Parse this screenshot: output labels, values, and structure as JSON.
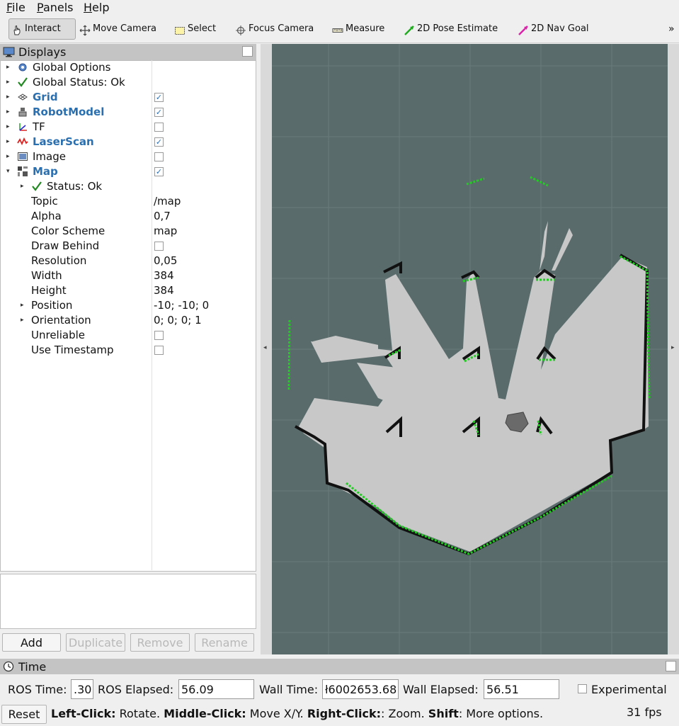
{
  "menubar": {
    "items": [
      {
        "label": "File"
      },
      {
        "label": "Panels"
      },
      {
        "label": "Help"
      }
    ]
  },
  "toolbar": {
    "tools": [
      {
        "label": "Interact",
        "icon": "hand-pointer-icon",
        "active": true
      },
      {
        "label": "Move Camera",
        "icon": "move-arrows-icon"
      },
      {
        "label": "Select",
        "icon": "select-rectangle-icon"
      },
      {
        "label": "Focus Camera",
        "icon": "focus-crosshair-icon"
      },
      {
        "label": "Measure",
        "icon": "ruler-icon"
      },
      {
        "label": "2D Pose Estimate",
        "icon": "green-arrow-icon"
      },
      {
        "label": "2D Nav Goal",
        "icon": "magenta-arrow-icon"
      }
    ],
    "overflow": "»"
  },
  "displays": {
    "title": "Displays",
    "rows": [
      {
        "label": "Global Options",
        "icon": "gear-icon",
        "arrow": "▸"
      },
      {
        "label": "Global Status: Ok",
        "icon": "check-icon",
        "arrow": "▸"
      },
      {
        "label": "Grid",
        "icon": "grid-icon",
        "arrow": "▸",
        "checked": true,
        "bold": true
      },
      {
        "label": "RobotModel",
        "icon": "robot-icon",
        "arrow": "▸",
        "checked": true,
        "bold": true
      },
      {
        "label": "TF",
        "icon": "tf-axes-icon",
        "arrow": "▸",
        "checked": false
      },
      {
        "label": "LaserScan",
        "icon": "laser-wave-icon",
        "arrow": "▸",
        "checked": true,
        "bold": true
      },
      {
        "label": "Image",
        "icon": "image-icon",
        "arrow": "▸",
        "checked": false
      },
      {
        "label": "Map",
        "icon": "map-icon",
        "arrow": "▾",
        "checked": true,
        "bold": true
      },
      {
        "label": "Status: Ok",
        "icon": "check-icon",
        "arrow": "▸",
        "child": true
      },
      {
        "label": "Topic",
        "value": "/map",
        "prop": true
      },
      {
        "label": "Alpha",
        "value": "0,7",
        "prop": true
      },
      {
        "label": "Color Scheme",
        "value": "map",
        "prop": true
      },
      {
        "label": "Draw Behind",
        "checked": false,
        "prop": true
      },
      {
        "label": "Resolution",
        "value": "0,05",
        "prop": true
      },
      {
        "label": "Width",
        "value": "384",
        "prop": true
      },
      {
        "label": "Height",
        "value": "384",
        "prop": true
      },
      {
        "label": "Position",
        "value": "-10; -10; 0",
        "prop": true,
        "arrow": "▸"
      },
      {
        "label": "Orientation",
        "value": "0; 0; 0; 1",
        "prop": true,
        "arrow": "▸"
      },
      {
        "label": "Unreliable",
        "checked": false,
        "prop": true
      },
      {
        "label": "Use Timestamp",
        "checked": false,
        "prop": true
      }
    ],
    "buttons": {
      "add": "Add",
      "duplicate": "Duplicate",
      "remove": "Remove",
      "rename": "Rename"
    }
  },
  "viewport": {
    "background": "#5a6b6b",
    "free_space": "#c8c8c8",
    "wall": "#111111",
    "laser": "#22cc22"
  },
  "time": {
    "title": "Time",
    "ros_time_label": "ROS Time:",
    "ros_time_value": ".30",
    "ros_elapsed_label": "ROS Elapsed:",
    "ros_elapsed_value": "56.09",
    "wall_time_label": "Wall Time:",
    "wall_time_value": "ł6002653.68",
    "wall_elapsed_label": "Wall Elapsed:",
    "wall_elapsed_value": "56.51",
    "experimental_label": "Experimental",
    "reset_label": "Reset",
    "hint_left_key": "Left-Click:",
    "hint_left": " Rotate. ",
    "hint_middle_key": "Middle-Click:",
    "hint_middle": " Move X/Y. ",
    "hint_right_key": "Right-Click:",
    "hint_right": ": Zoom. ",
    "hint_shift_key": "Shift",
    "hint_shift": ": More options.",
    "fps": "31 fps"
  }
}
